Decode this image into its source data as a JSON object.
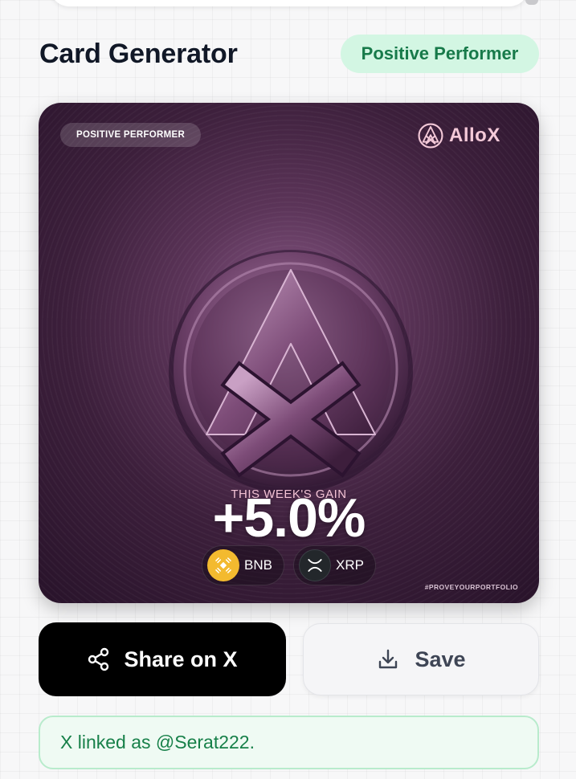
{
  "header": {
    "title": "Card Generator",
    "badge": "Positive Performer"
  },
  "card": {
    "badge": "POSITIVE PERFORMER",
    "brand": "AlloX",
    "gain_label": "THIS WEEK'S GAIN",
    "gain_value": "+5.0%",
    "coins": [
      {
        "symbol": "BNB",
        "icon": "bnb-icon"
      },
      {
        "symbol": "XRP",
        "icon": "xrp-icon"
      }
    ],
    "hashtag": "#PROVEYOURPORTFOLIO"
  },
  "actions": {
    "share_label": "Share on X",
    "save_label": "Save"
  },
  "status": {
    "message": "X linked as @Serat222."
  },
  "colors": {
    "badge_bg": "#d3f6e3",
    "badge_text": "#177a4a",
    "card_purple": "#5b3458",
    "status_text": "#178049"
  }
}
